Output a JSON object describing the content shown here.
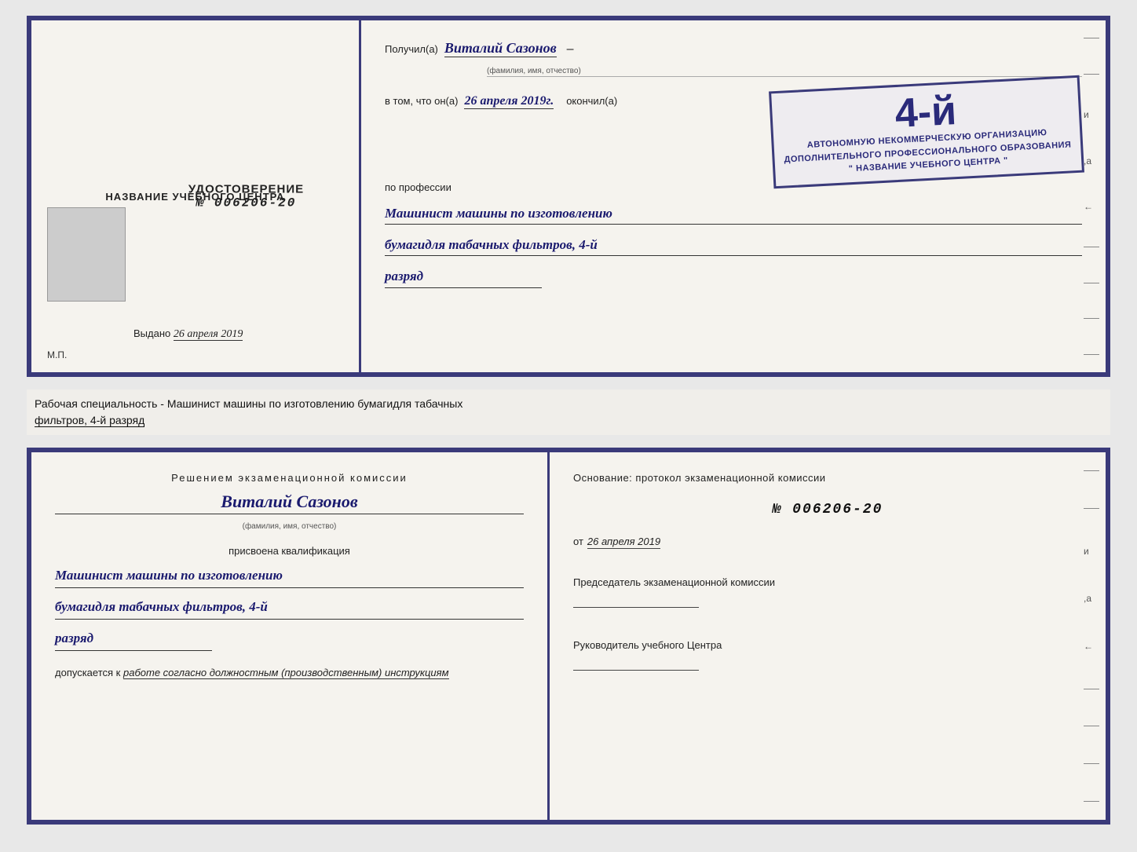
{
  "top_cert": {
    "left": {
      "title": "НАЗВАНИЕ УЧЕБНОГО ЦЕНТРА",
      "udostoverenie_label": "УДОСТОВЕРЕНИЕ",
      "number": "№ 006206-20",
      "vudano_label": "Выдано",
      "vudano_date": "26 апреля 2019",
      "mp_label": "М.П."
    },
    "right": {
      "poluchil_label": "Получил(a)",
      "recipient_name": "Виталий Сазонов",
      "recipient_name_sublabel": "(фамилия, имя, отчество)",
      "vtom_label": "в том, что он(а)",
      "date_handwritten": "26 апреля 2019г.",
      "okonchil_label": "окончил(а)",
      "stamp_line1": "АВТОНОМНУЮ НЕКОММЕРЧЕСКУЮ ОРГАНИЗАЦИЮ",
      "stamp_line2": "ДОПОЛНИТЕЛЬНОГО ПРОФЕССИОНАЛЬНОГО ОБРАЗОВАНИЯ",
      "stamp_line3": "\" НАЗВАНИЕ УЧЕБНОГО ЦЕНТРА \"",
      "stamp_big": "4-й",
      "po_professii_label": "по профессии",
      "profession_line1": "Машинист машины по изготовлению",
      "profession_line2": "бумагидля табачных фильтров, 4-й",
      "profession_line3": "разряд",
      "side_chars": [
        "–",
        "–",
        "и",
        "а",
        "←",
        "–",
        "–",
        "–",
        "–"
      ]
    }
  },
  "middle": {
    "text": "Рабочая специальность - Машинист машины по изготовлению бумагидля табачных фильтров, 4-й разряд"
  },
  "bottom_cert": {
    "left": {
      "title": "Решением  экзаменационной  комиссии",
      "name": "Виталий Сазонов",
      "name_sublabel": "(фамилия, имя, отчество)",
      "prisvoena_label": "присвоена квалификация",
      "profession_line1": "Машинист машины по изготовлению",
      "profession_line2": "бумагидля табачных фильтров, 4-й",
      "profession_line3": "разряд",
      "dopuskaetsya_label": "допускается к",
      "dopuskaetsya_value": "работе согласно должностным (производственным) инструкциям"
    },
    "right": {
      "osnovanie_label": "Основание:  протокол  экзаменационной  комиссии",
      "number": "№  006206-20",
      "ot_label": "от",
      "ot_date": "26 апреля 2019",
      "predsedatel_label": "Председатель экзаменационной комиссии",
      "rukovoditel_label": "Руководитель учебного Центра",
      "side_chars": [
        "–",
        "–",
        "и",
        "а",
        "←",
        "–",
        "–",
        "–",
        "–"
      ]
    }
  }
}
